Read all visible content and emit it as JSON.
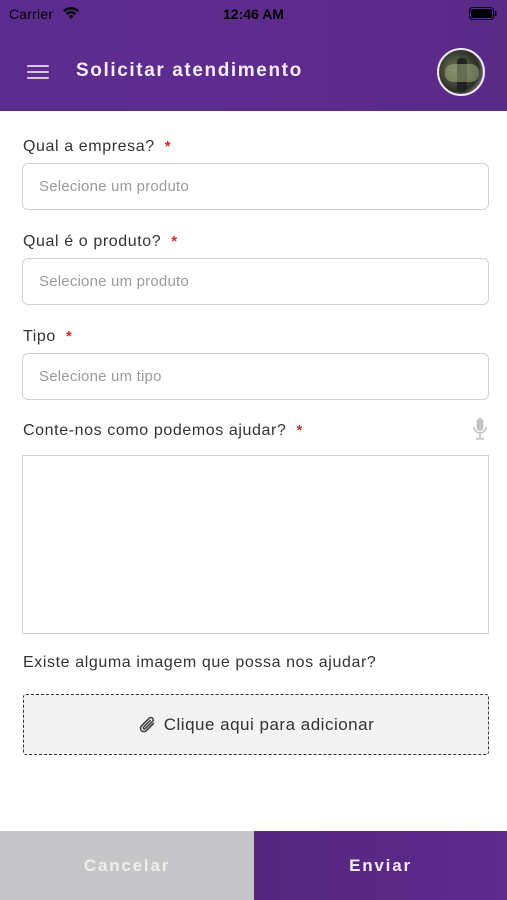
{
  "status_bar": {
    "carrier": "Carrier",
    "time": "12:46 AM",
    "wifi_icon": "wifi-icon",
    "battery_icon": "battery-icon"
  },
  "nav": {
    "title": "Solicitar atendimento",
    "menu_icon": "hamburger-menu-icon",
    "avatar": "user-avatar"
  },
  "form": {
    "company": {
      "label": "Qual a empresa?",
      "required_mark": "*",
      "placeholder": "Selecione um produto",
      "value": ""
    },
    "product": {
      "label": "Qual é o produto?",
      "required_mark": "*",
      "placeholder": "Selecione um produto",
      "value": ""
    },
    "type": {
      "label": "Tipo",
      "required_mark": "*",
      "placeholder": "Selecione um tipo",
      "value": ""
    },
    "description": {
      "label": "Conte-nos como podemos ajudar?",
      "required_mark": "*",
      "value": "",
      "mic_icon": "microphone-icon"
    },
    "image": {
      "label": "Existe alguma imagem que possa nos ajudar?",
      "button_label": "Clique aqui para adicionar",
      "icon": "paperclip-icon"
    }
  },
  "actions": {
    "cancel_label": "Cancelar",
    "send_label": "Enviar"
  },
  "colors": {
    "primary": "#5b2c8f",
    "required": "#e0262a",
    "cancel_bg": "#c6c6c8"
  }
}
